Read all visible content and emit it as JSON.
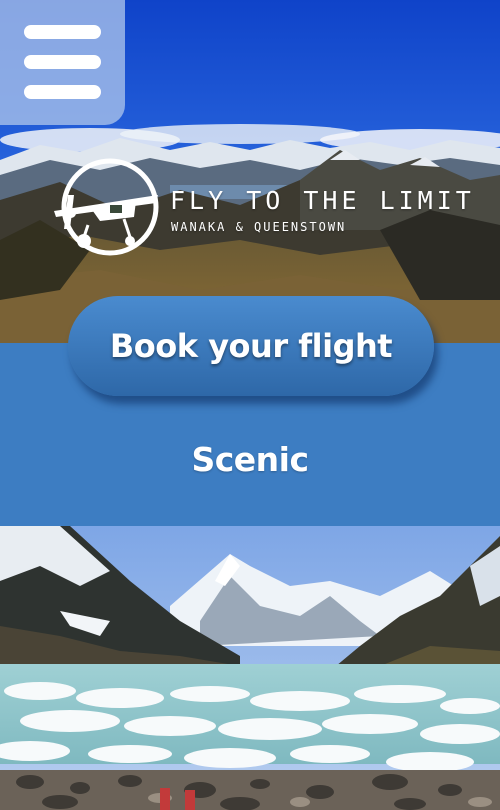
{
  "header": {
    "menu_icon": "hamburger-menu-icon",
    "logo_icon": "plane-logo-icon",
    "brand_title": "FLY TO THE LIMIT",
    "brand_subtitle": "WANAKA & QUEENSTOWN"
  },
  "cta": {
    "book_label": "Book your flight"
  },
  "section": {
    "title": "Scenic"
  },
  "colors": {
    "page_background": "#3d7dc2",
    "button_top": "#4a8bcf",
    "button_bottom": "#2e68a8",
    "text": "#ffffff"
  }
}
